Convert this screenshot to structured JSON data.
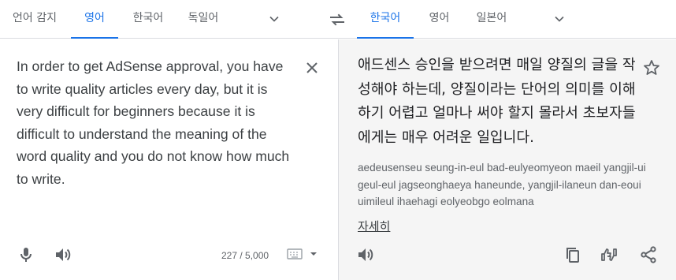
{
  "source_languages": [
    {
      "label": "언어 감지",
      "active": false
    },
    {
      "label": "영어",
      "active": true
    },
    {
      "label": "한국어",
      "active": false
    },
    {
      "label": "독일어",
      "active": false
    }
  ],
  "target_languages": [
    {
      "label": "한국어",
      "active": true
    },
    {
      "label": "영어",
      "active": false
    },
    {
      "label": "일본어",
      "active": false
    }
  ],
  "source": {
    "text": "In order to get AdSense approval, you have to write quality articles every day, but it is very difficult for beginners because it is difficult to understand the meaning of the word quality and you do not know how much to write.",
    "char_count": "227 / 5,000"
  },
  "target": {
    "text": "애드센스 승인을 받으려면 매일 양질의 글을 작성해야 하는데, 양질이라는 단어의 의미를 이해하기 어렵고 얼마나 써야 할지 몰라서 초보자들에게는 매우 어려운 일입니다.",
    "romanization": "aedeusenseu seung-in-eul bad-eulyeomyeon maeil yangjil-ui geul-eul jagseonghaeya haneunde, yangjil-ilaneun dan-eoui uimileul ihaehagi eolyeobgo eolmana",
    "more_label": "자세히"
  },
  "colors": {
    "accent": "#1a73e8",
    "icon": "#5f6368",
    "target_bg": "#f5f5f5",
    "divider": "#dadce0"
  },
  "icons": [
    "chevron-down-icon",
    "swap-icon",
    "close-icon",
    "star-icon",
    "mic-icon",
    "speaker-icon",
    "keyboard-icon",
    "copy-icon",
    "feedback-icon",
    "share-icon"
  ]
}
